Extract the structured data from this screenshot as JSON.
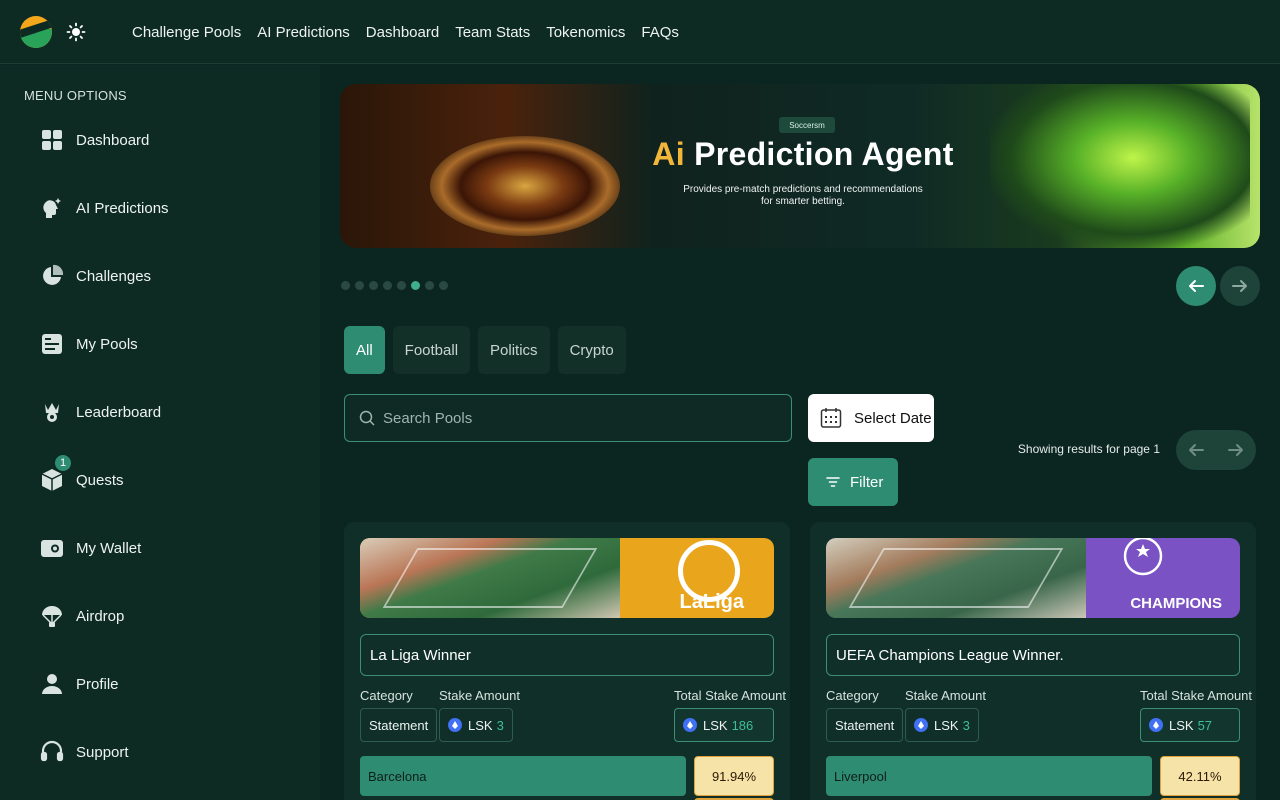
{
  "nav": {
    "items": [
      "Challenge Pools",
      "AI Predictions",
      "Dashboard",
      "Team Stats",
      "Tokenomics",
      "FAQs"
    ]
  },
  "sidebar": {
    "title": "MENU OPTIONS",
    "items": [
      {
        "label": "Dashboard",
        "icon": "dashboard-icon"
      },
      {
        "label": "AI Predictions",
        "icon": "ai-predictions-icon"
      },
      {
        "label": "Challenges",
        "icon": "challenges-icon"
      },
      {
        "label": "My Pools",
        "icon": "pools-icon"
      },
      {
        "label": "Leaderboard",
        "icon": "trophy-icon"
      },
      {
        "label": "Quests",
        "icon": "cube-icon",
        "badge": "1"
      },
      {
        "label": "My Wallet",
        "icon": "wallet-icon"
      },
      {
        "label": "Airdrop",
        "icon": "parachute-icon"
      },
      {
        "label": "Profile",
        "icon": "user-icon"
      },
      {
        "label": "Support",
        "icon": "headset-icon"
      }
    ]
  },
  "banner": {
    "brand": "Soccersm",
    "title_accent": "Ai",
    "title_rest": " Prediction Agent",
    "subtitle_line1": "Provides pre-match predictions and recommendations",
    "subtitle_line2": "for smarter betting."
  },
  "carousel": {
    "total": 8,
    "active_index": 5
  },
  "filters": {
    "tabs": [
      "All",
      "Football",
      "Politics",
      "Crypto"
    ],
    "active": "All"
  },
  "search": {
    "placeholder": "Search Pools",
    "value": ""
  },
  "date_button": "Select Date",
  "filter_button": "Filter",
  "results_text": "Showing results for page 1",
  "cards": [
    {
      "name": "La Liga Winner",
      "logo_text": "LaLiga",
      "banner_color": "#e9a51c",
      "labels": {
        "category": "Category",
        "stake": "Stake Amount",
        "total": "Total Stake Amount"
      },
      "category": "Statement",
      "stake_currency": "LSK",
      "stake": "3",
      "total_currency": "LSK",
      "total": "186",
      "option": "Barcelona",
      "percent": "91.94%"
    },
    {
      "name": "UEFA Champions League Winner.",
      "logo_text": "CHAMPIONS",
      "banner_color": "#7a52c4",
      "labels": {
        "category": "Category",
        "stake": "Stake Amount",
        "total": "Total Stake Amount"
      },
      "category": "Statement",
      "stake_currency": "LSK",
      "stake": "3",
      "total_currency": "LSK",
      "total": "57",
      "option": "Liverpool",
      "percent": "42.11%"
    }
  ],
  "colors": {
    "background": "#0b2620",
    "accent": "#2e8c72",
    "highlight": "#f2b63a"
  }
}
